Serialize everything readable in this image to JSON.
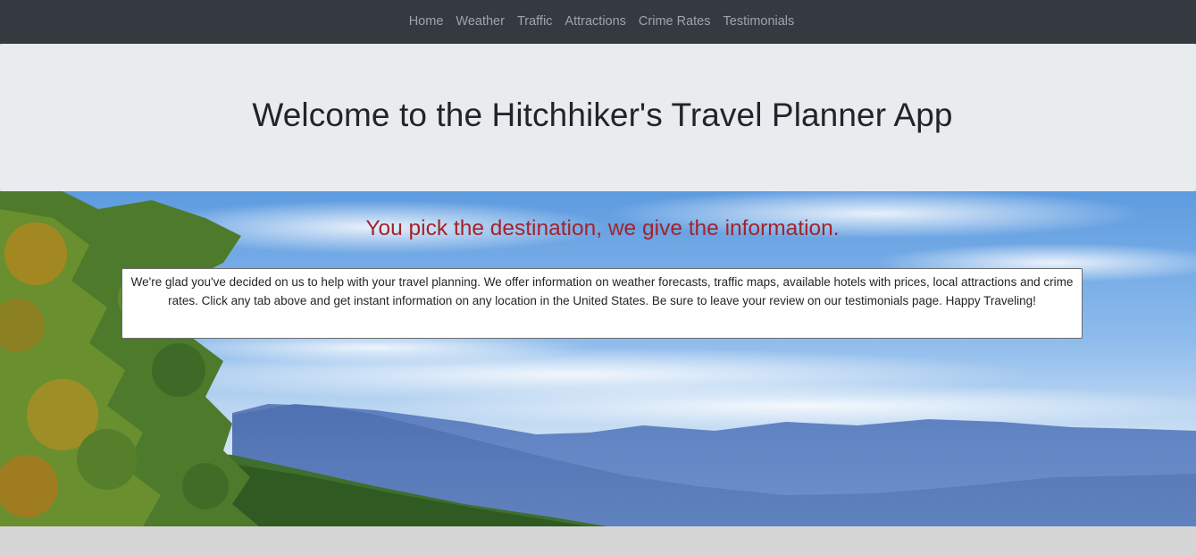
{
  "nav": {
    "items": [
      {
        "label": "Home"
      },
      {
        "label": "Weather"
      },
      {
        "label": "Traffic"
      },
      {
        "label": "Attractions"
      },
      {
        "label": "Crime Rates"
      },
      {
        "label": "Testimonials"
      }
    ]
  },
  "header": {
    "title": "Welcome to the Hitchhiker's Travel Planner App"
  },
  "hero": {
    "tagline": "You pick the destination, we give the information.",
    "intro": "We're glad you've decided on us to help with your travel planning. We offer information on weather forecasts, traffic maps, available hotels with prices, local attractions and crime rates. Click any tab above and get instant information on any location in the United States. Be sure to leave your review on our testimonials page. Happy Traveling!"
  },
  "colors": {
    "navbar": "#343a40",
    "nav_link": "#9ea4a9",
    "jumbotron": "#e9ecef",
    "tagline": "#a0242c"
  }
}
